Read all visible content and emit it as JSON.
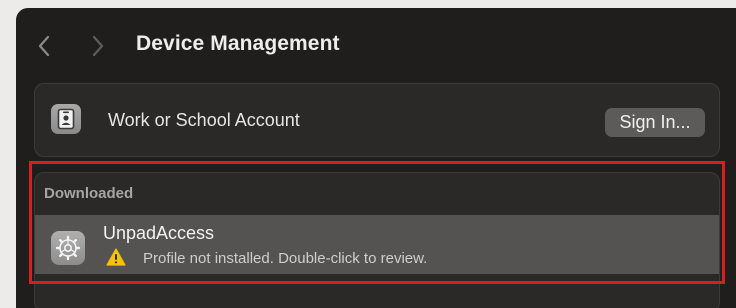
{
  "header": {
    "title": "Device Management",
    "back_icon": "chevron-left-icon",
    "forward_icon": "chevron-right-icon"
  },
  "account": {
    "icon": "id-badge-icon",
    "label": "Work or School Account",
    "sign_in_label": "Sign In..."
  },
  "downloaded": {
    "header": "Downloaded",
    "profiles": [
      {
        "icon": "gear-icon",
        "name": "UnpadAccess",
        "status_icon": "warning-icon",
        "status": "Profile not installed. Double-click to review."
      }
    ]
  },
  "annotation": {
    "highlight_color": "#d81e1e"
  },
  "colors": {
    "window_background": "#1f1e1d",
    "card_background": "#2a2928",
    "selected_row": "#545351",
    "warning": "#f5c400"
  }
}
